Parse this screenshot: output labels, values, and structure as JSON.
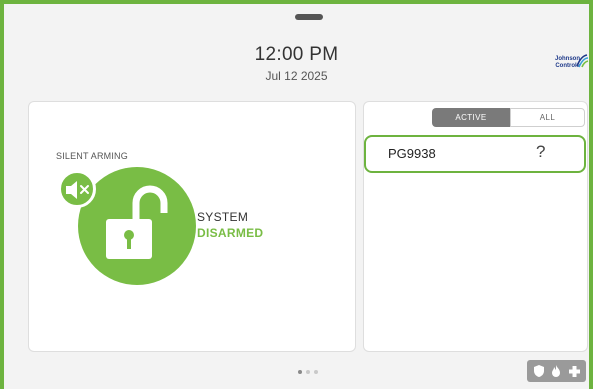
{
  "header": {
    "time": "12:00 PM",
    "date": "Jul 12 2025",
    "brand_line1": "Johnson",
    "brand_line2": "Controls"
  },
  "security_panel": {
    "silent_arming_label": "SILENT ARMING",
    "status_line1": "SYSTEM",
    "status_line2": "DISARMED",
    "lock_state": "unlocked",
    "mute_icon": "speaker-muted-icon"
  },
  "sensor_panel": {
    "tabs": [
      {
        "label": "ACTIVE",
        "selected": true
      },
      {
        "label": "ALL",
        "selected": false
      }
    ],
    "sensors": [
      {
        "name": "PG9938",
        "status": "?"
      }
    ]
  },
  "pager": {
    "pages": 3,
    "current": 1
  },
  "emergency_button": {
    "icons": [
      "police-shield-icon",
      "fire-icon",
      "medical-cross-icon"
    ]
  },
  "colors": {
    "accent_green": "#79bd45",
    "frame_green": "#6db33f",
    "tab_active_gray": "#7a7a7a"
  }
}
